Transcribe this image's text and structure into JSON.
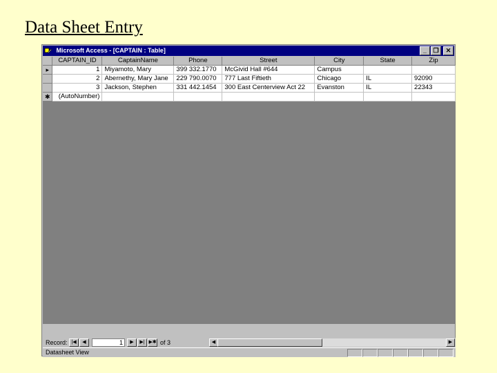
{
  "slide": {
    "title": "Data Sheet Entry"
  },
  "window": {
    "title": "Microsoft Access - [CAPTAIN : Table]",
    "buttons": {
      "minimize": "_",
      "restore": "❐",
      "close": "✕"
    }
  },
  "table": {
    "columns": [
      "CAPTAIN_ID",
      "CaptainName",
      "Phone",
      "Street",
      "City",
      "State",
      "Zip"
    ],
    "rows": [
      {
        "selector": "▸",
        "id": "1",
        "name": "Miyamoto, Mary",
        "phone": "399 332.1770",
        "street": "McGivid Hall #644",
        "city": "Campus",
        "state": "",
        "zip": ""
      },
      {
        "selector": "",
        "id": "2",
        "name": "Abernethy, Mary Jane",
        "phone": "229 790.0070",
        "street": "777 Last Fiftieth",
        "city": "Chicago",
        "state": "IL",
        "zip": "92090"
      },
      {
        "selector": "",
        "id": "3",
        "name": "Jackson, Stephen",
        "phone": "331 442.1454",
        "street": "300 East Centerview Act 22",
        "city": "Evanston",
        "state": "IL",
        "zip": "22343"
      }
    ],
    "new_row": {
      "selector": "✱",
      "id": "(AutoNumber)"
    }
  },
  "navigation": {
    "label": "Record:",
    "current": "1",
    "of_label": "of 3",
    "first": "|◀",
    "prev": "◀",
    "next": "▶",
    "last": "▶|",
    "new": "▶✱"
  },
  "status": {
    "text": "Datasheet View"
  }
}
